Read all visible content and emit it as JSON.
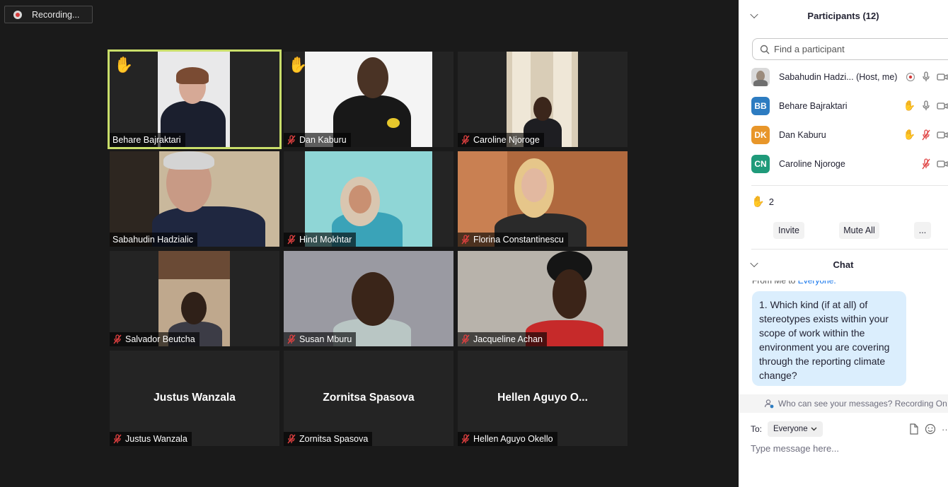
{
  "recording": {
    "label": "Recording..."
  },
  "tiles": [
    {
      "name": "Behare Bajraktari",
      "muted": false,
      "hand": true,
      "active": true
    },
    {
      "name": "Dan Kaburu",
      "muted": true,
      "hand": true
    },
    {
      "name": "Caroline Njoroge",
      "muted": true
    },
    {
      "name": "Sabahudin Hadzialic",
      "muted": false
    },
    {
      "name": "Hind Mokhtar",
      "muted": true
    },
    {
      "name": "Florina Constantinescu",
      "muted": true
    },
    {
      "name": "Salvador Beutcha",
      "muted": true
    },
    {
      "name": "Susan Mburu",
      "muted": true
    },
    {
      "name": "Jacqueline Achan",
      "muted": true
    },
    {
      "name": "Justus Wanzala",
      "muted": true,
      "display_name": "Justus Wanzala"
    },
    {
      "name": "Zornitsa Spasova",
      "muted": true,
      "display_name": "Zornitsa Spasova"
    },
    {
      "name": "Hellen Aguyo Okello",
      "muted": true,
      "display_name": "Hellen Aguyo O..."
    }
  ],
  "participants": {
    "title": "Participants (12)",
    "search_placeholder": "Find a participant",
    "list": [
      {
        "name": "Sabahudin Hadzi... (Host, me)",
        "initials": "",
        "color": "#cfcfcf"
      },
      {
        "name": "Behare Bajraktari",
        "initials": "BB",
        "color": "#2d7cc1"
      },
      {
        "name": "Dan Kaburu",
        "initials": "DK",
        "color": "#e8962a"
      },
      {
        "name": "Caroline Njoroge",
        "initials": "CN",
        "color": "#1f9a7a"
      }
    ],
    "raised_count": "2",
    "invite_label": "Invite",
    "mute_all_label": "Mute All",
    "more_label": "..."
  },
  "chat": {
    "title": "Chat",
    "from_prefix": "From Me to ",
    "from_target": "Everyone:",
    "message": "1.        Which kind (if at all) of stereotypes exists within your scope of work within the environment you are covering through the reporting climate change?",
    "notice": "Who can see your messages? Recording On",
    "to_label": "To:",
    "to_value": "Everyone",
    "input_placeholder": "Type message here..."
  }
}
